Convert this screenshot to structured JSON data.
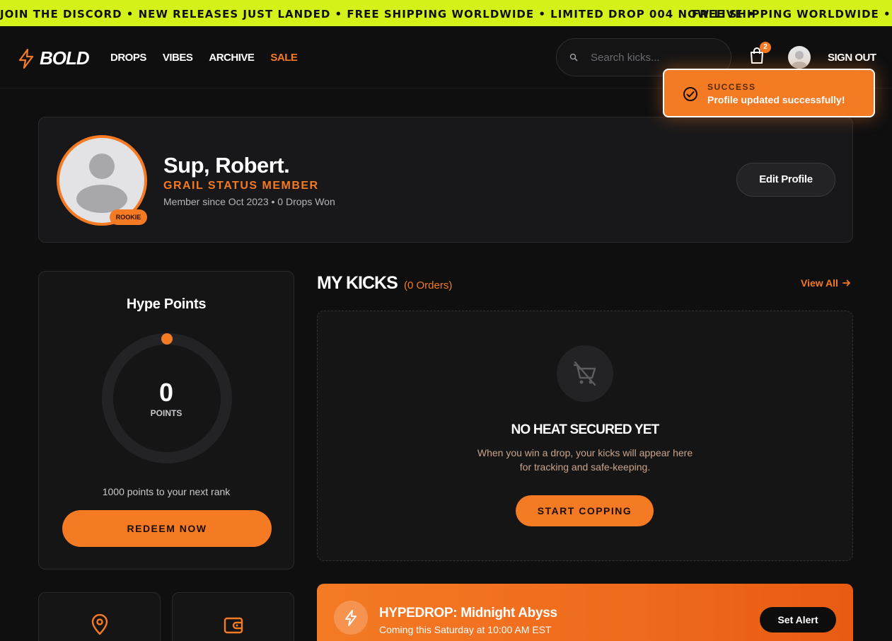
{
  "ticker": {
    "text": "JOIN THE DISCORD • NEW RELEASES JUST LANDED • FREE SHIPPING WORLDWIDE • LIMITED DROP 004 NOW LIVE •",
    "text_repeat": "FREE SHIPPING WORLDWIDE • LIMI",
    "bg_color": "#d4f21a"
  },
  "header": {
    "logo": "BOLD",
    "nav": [
      "DROPS",
      "VIBES",
      "ARCHIVE",
      "SALE"
    ],
    "search_placeholder": "Search kicks...",
    "cart_count": "2",
    "sign_out": "SIGN OUT"
  },
  "toast": {
    "title": "SUCCESS",
    "message": "Profile updated successfully!"
  },
  "profile": {
    "greeting": "Sup, Robert.",
    "status": "GRAIL STATUS MEMBER",
    "meta": "Member since Oct 2023 • 0 Drops Won",
    "rank_badge": "ROOKIE",
    "edit_button": "Edit Profile"
  },
  "hype": {
    "title": "Hype Points",
    "points": "0",
    "points_label": "POINTS",
    "progress": 0,
    "next_rank": "1000 points to your next rank",
    "redeem_button": "REDEEM NOW"
  },
  "kicks": {
    "title": "MY KICKS",
    "count": "(0 Orders)",
    "view_all": "View All",
    "empty_title": "NO HEAT SECURED YET",
    "empty_desc_1": "When you win a drop, your kicks will appear here",
    "empty_desc_2": "for tracking and safe-keeping.",
    "start_button": "START COPPING"
  },
  "hypedrop": {
    "title": "HYPEDROP: Midnight Abyss",
    "subtitle": "Coming this Saturday at 10:00 AM EST",
    "alert_button": "Set Alert"
  },
  "mini_cards": [
    {
      "icon": "map-pin-icon"
    },
    {
      "icon": "wallet-icon"
    }
  ],
  "colors": {
    "accent": "#f47a24",
    "background": "#0f0f10",
    "card": "#18181a"
  }
}
